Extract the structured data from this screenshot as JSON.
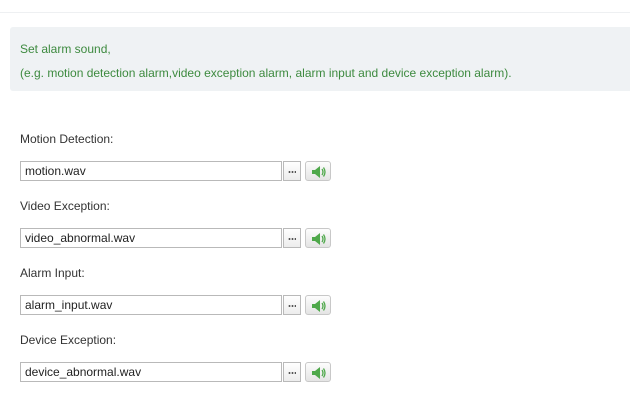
{
  "info": {
    "line1": "Set alarm sound,",
    "line2": "(e.g. motion detection alarm,video exception alarm, alarm input and device exception alarm)."
  },
  "alarms": [
    {
      "label": "Motion Detection:",
      "file": "motion.wav"
    },
    {
      "label": "Video Exception:",
      "file": "video_abnormal.wav"
    },
    {
      "label": "Alarm Input:",
      "file": "alarm_input.wav"
    },
    {
      "label": "Device Exception:",
      "file": "device_abnormal.wav"
    }
  ],
  "icons": {
    "browse": "ellipsis-icon",
    "play": "speaker-icon"
  },
  "colors": {
    "info_text": "#3d8a3f",
    "info_background": "#eff2f4",
    "speaker": "#4ea84a"
  }
}
